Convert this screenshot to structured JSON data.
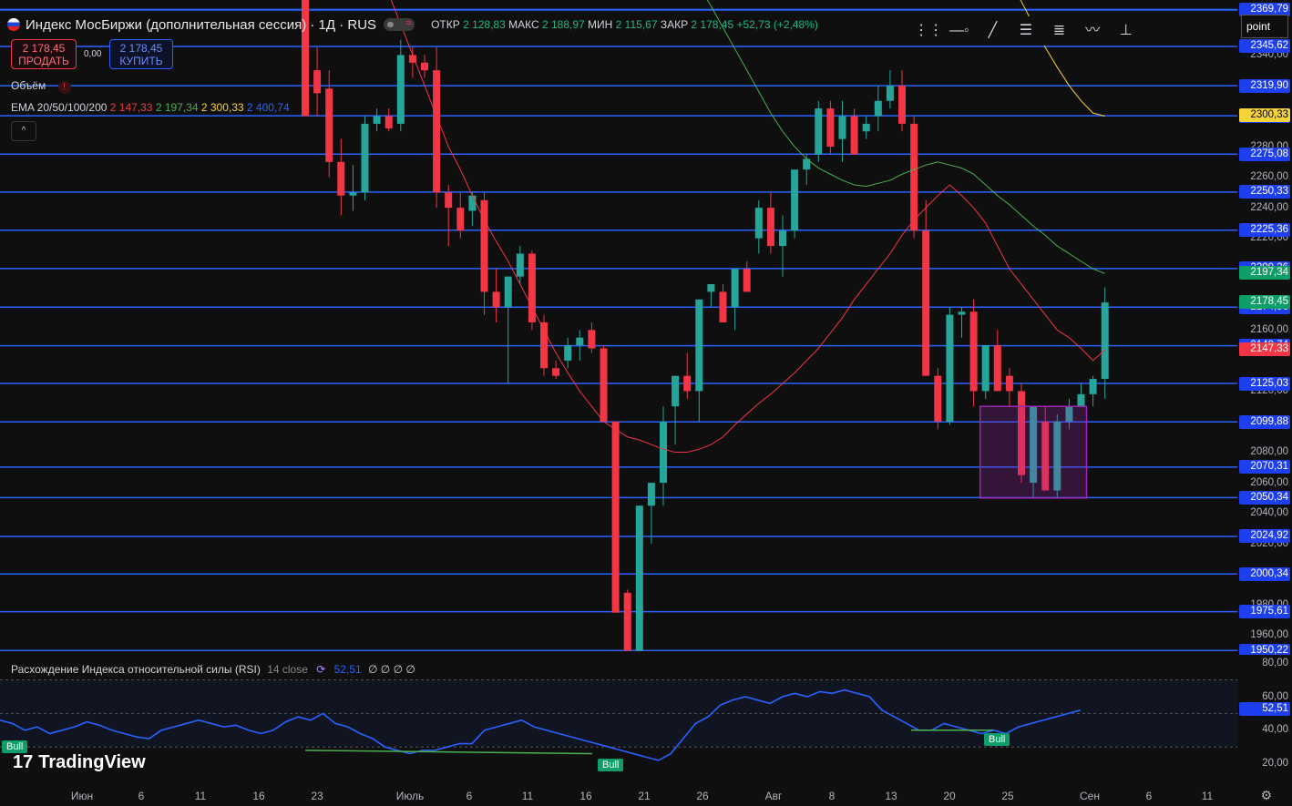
{
  "header": {
    "title": "Индекс МосБиржи (дополнительная сессия) · 1Д · RUS",
    "ohlc": [
      {
        "k": "ОТКР",
        "v": "2 128,83"
      },
      {
        "k": "МАКС",
        "v": "2 188,97"
      },
      {
        "k": "МИН",
        "v": "2 115,67"
      },
      {
        "k": "ЗАКР",
        "v": "2 178,45"
      }
    ],
    "change": "+52,73 (+2,48%)"
  },
  "trade": {
    "sell_price": "2 178,45",
    "sell_label": "ПРОДАТЬ",
    "buy_price": "2 178,45",
    "buy_label": "КУПИТЬ",
    "spread": "0,00"
  },
  "indicators": {
    "volume_label": "Объём",
    "ema_label": "EMA 20/50/100/200",
    "ema_values": [
      "2 147,33",
      "2 197,34",
      "2 300,33",
      "2 400,74"
    ],
    "ema_colors": [
      "#f23645",
      "#4caf50",
      "#f7d33a",
      "#2962ff"
    ]
  },
  "rsi": {
    "label": "Расхождение Индекса относительной силы (RSI)",
    "params": "14 close",
    "value": "52,51",
    "extras": "∅ ∅ ∅ ∅",
    "ticks": [
      "80,00",
      "60,00",
      "40,00",
      "20,00"
    ],
    "bull_labels": [
      "Bull",
      "Bull",
      "Bull"
    ]
  },
  "toolbar": {
    "mode": "point",
    "tools": [
      "drag-handle-icon",
      "horizontal-ray-icon",
      "trend-line-icon",
      "fib-icon",
      "pitchfork-icon",
      "path-icon",
      "measure-icon"
    ]
  },
  "brand": "TradingView",
  "xaxis": [
    "Июн",
    "6",
    "11",
    "16",
    "23",
    "Июль",
    "6",
    "11",
    "16",
    "21",
    "26",
    "Авг",
    "8",
    "13",
    "20",
    "25",
    "Сен",
    "6",
    "11"
  ],
  "price_levels": [
    "2369,79",
    "2345,62",
    "2319,90",
    "2300,22",
    "2275,08",
    "2250,33",
    "2225,36",
    "2200,26",
    "2174,96",
    "2149,74",
    "2125,03",
    "2099,88",
    "2070,31",
    "2050,34",
    "2024,92",
    "2000,34",
    "1975,61",
    "1950,22"
  ],
  "axis_ticks": [
    "2360,00",
    "2340,00",
    "2280,00",
    "2260,00",
    "2240,00",
    "2220,00",
    "2160,00",
    "2120,00",
    "2080,00",
    "2060,00",
    "2040,00",
    "2020,00",
    "1980,00",
    "1960,00"
  ],
  "special_tags": [
    {
      "v": "2300,33",
      "style": "yellow"
    },
    {
      "v": "2197,34",
      "style": "green"
    },
    {
      "v": "2178,45",
      "style": "green"
    },
    {
      "v": "2147,33",
      "style": "red"
    }
  ],
  "colors": {
    "up": "#26a69a",
    "down": "#f23645",
    "level": "#2962ff",
    "box": "#9c27b0"
  },
  "chart_data": {
    "type": "candlestick",
    "ylim": [
      1948,
      2376
    ],
    "candles": [
      [
        2376,
        2376,
        2300,
        2300
      ],
      [
        2330,
        2345,
        2300,
        2315
      ],
      [
        2318,
        2330,
        2260,
        2270
      ],
      [
        2270,
        2285,
        2235,
        2248
      ],
      [
        2248,
        2268,
        2238,
        2250
      ],
      [
        2250,
        2300,
        2245,
        2295
      ],
      [
        2295,
        2305,
        2290,
        2300
      ],
      [
        2300,
        2305,
        2290,
        2292
      ],
      [
        2295,
        2350,
        2290,
        2340
      ],
      [
        2340,
        2345,
        2325,
        2335
      ],
      [
        2335,
        2340,
        2325,
        2330
      ],
      [
        2330,
        2345,
        2240,
        2250
      ],
      [
        2250,
        2255,
        2215,
        2240
      ],
      [
        2240,
        2250,
        2220,
        2225
      ],
      [
        2238,
        2250,
        2228,
        2248
      ],
      [
        2245,
        2250,
        2170,
        2185
      ],
      [
        2185,
        2200,
        2165,
        2175
      ],
      [
        2175,
        2195,
        2125,
        2195
      ],
      [
        2195,
        2215,
        2190,
        2210
      ],
      [
        2210,
        2212,
        2160,
        2165
      ],
      [
        2165,
        2170,
        2130,
        2135
      ],
      [
        2135,
        2140,
        2128,
        2130
      ],
      [
        2140,
        2155,
        2135,
        2150
      ],
      [
        2150,
        2160,
        2140,
        2155
      ],
      [
        2160,
        2165,
        2145,
        2148
      ],
      [
        2148,
        2150,
        2100,
        2100
      ],
      [
        2100,
        2100,
        1975,
        1975
      ],
      [
        1988,
        1990,
        1950,
        1950
      ],
      [
        1950,
        2045,
        1950,
        2045
      ],
      [
        2045,
        2060,
        2020,
        2060
      ],
      [
        2060,
        2110,
        2045,
        2100
      ],
      [
        2110,
        2130,
        2085,
        2130
      ],
      [
        2130,
        2145,
        2115,
        2120
      ],
      [
        2120,
        2180,
        2100,
        2180
      ],
      [
        2185,
        2190,
        2175,
        2190
      ],
      [
        2185,
        2190,
        2165,
        2165
      ],
      [
        2175,
        2200,
        2160,
        2200
      ],
      [
        2200,
        2205,
        2185,
        2185
      ],
      [
        2220,
        2245,
        2210,
        2240
      ],
      [
        2240,
        2250,
        2210,
        2215
      ],
      [
        2215,
        2235,
        2195,
        2225
      ],
      [
        2225,
        2265,
        2220,
        2265
      ],
      [
        2265,
        2275,
        2255,
        2272
      ],
      [
        2275,
        2310,
        2270,
        2305
      ],
      [
        2305,
        2310,
        2275,
        2280
      ],
      [
        2285,
        2310,
        2270,
        2300
      ],
      [
        2300,
        2305,
        2275,
        2275
      ],
      [
        2290,
        2300,
        2285,
        2295
      ],
      [
        2300,
        2320,
        2290,
        2310
      ],
      [
        2310,
        2330,
        2305,
        2320
      ],
      [
        2320,
        2330,
        2290,
        2295
      ],
      [
        2295,
        2300,
        2220,
        2225
      ],
      [
        2225,
        2245,
        2130,
        2130
      ],
      [
        2130,
        2135,
        2095,
        2100
      ],
      [
        2100,
        2175,
        2098,
        2170
      ],
      [
        2170,
        2175,
        2155,
        2172
      ],
      [
        2172,
        2180,
        2110,
        2120
      ],
      [
        2120,
        2150,
        2115,
        2150
      ],
      [
        2150,
        2160,
        2120,
        2120
      ],
      [
        2130,
        2135,
        2110,
        2120
      ],
      [
        2120,
        2125,
        2060,
        2065
      ],
      [
        2060,
        2110,
        2050,
        2110
      ],
      [
        2100,
        2110,
        2060,
        2055
      ],
      [
        2055,
        2105,
        2050,
        2100
      ],
      [
        2100,
        2115,
        2095,
        2110
      ],
      [
        2110,
        2125,
        2110,
        2118
      ],
      [
        2118,
        2130,
        2110,
        2128
      ],
      [
        2128,
        2188,
        2115,
        2178
      ]
    ],
    "ema20": [
      2400,
      2380,
      2360,
      2340,
      2320,
      2300,
      2280,
      2265,
      2248,
      2232,
      2218,
      2205,
      2190,
      2175,
      2160,
      2145,
      2132,
      2120,
      2110,
      2100,
      2095,
      2090,
      2088,
      2085,
      2082,
      2080,
      2080,
      2082,
      2085,
      2090,
      2098,
      2105,
      2112,
      2118,
      2125,
      2132,
      2140,
      2148,
      2158,
      2168,
      2180,
      2190,
      2200,
      2210,
      2222,
      2232,
      2240,
      2248,
      2255,
      2248,
      2240,
      2230,
      2215,
      2200,
      2190,
      2180,
      2170,
      2160,
      2155,
      2148,
      2140,
      2147
    ],
    "ema50": [
      2420,
      2410,
      2398,
      2385,
      2372,
      2358,
      2344,
      2330,
      2316,
      2302,
      2290,
      2280,
      2272,
      2266,
      2262,
      2258,
      2255,
      2254,
      2256,
      2258,
      2262,
      2265,
      2268,
      2270,
      2268,
      2266,
      2262,
      2255,
      2248,
      2242,
      2235,
      2228,
      2222,
      2215,
      2210,
      2205,
      2200,
      2197
    ],
    "ema100": [
      2420,
      2405,
      2390,
      2375,
      2360,
      2345,
      2332,
      2320,
      2310,
      2302,
      2300
    ],
    "rsi_values": [
      46,
      44,
      40,
      42,
      38,
      40,
      42,
      45,
      43,
      40,
      38,
      36,
      35,
      40,
      42,
      44,
      46,
      44,
      42,
      43,
      40,
      38,
      40,
      45,
      48,
      46,
      50,
      44,
      42,
      38,
      35,
      30,
      28,
      26,
      28,
      28,
      30,
      32,
      32,
      40,
      42,
      44,
      46,
      42,
      40,
      38,
      36,
      34,
      32,
      30,
      28,
      26,
      24,
      22,
      26,
      35,
      44,
      48,
      55,
      58,
      60,
      58,
      56,
      60,
      62,
      60,
      63,
      62,
      64,
      62,
      60,
      52,
      48,
      44,
      40,
      40,
      44,
      42,
      40,
      38,
      40,
      38,
      42,
      44,
      46,
      48,
      50,
      52
    ],
    "rsi_ylim": [
      10,
      85
    ]
  }
}
